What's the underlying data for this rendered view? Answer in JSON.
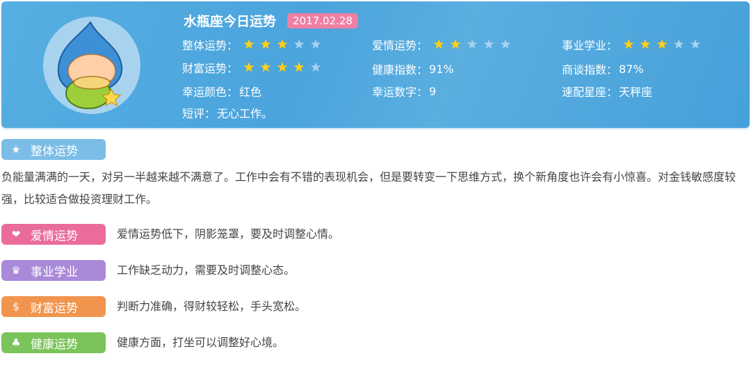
{
  "header": {
    "title": "水瓶座今日运势",
    "date": "2017.02.28"
  },
  "ratings": [
    {
      "label": "整体运势：",
      "stars": 3,
      "max": 5
    },
    {
      "label": "爱情运势：",
      "stars": 2,
      "max": 5
    },
    {
      "label": "事业学业：",
      "stars": 3,
      "max": 5
    },
    {
      "label": "财富运势：",
      "stars": 4,
      "max": 5
    }
  ],
  "stats": {
    "health": {
      "label": "健康指数：",
      "value": "91%"
    },
    "negotiation": {
      "label": "商谈指数：",
      "value": "87%"
    },
    "lucky_color": {
      "label": "幸运颜色：",
      "value": "红色"
    },
    "lucky_number": {
      "label": "幸运数字：",
      "value": "9"
    },
    "match": {
      "label": "速配星座：",
      "value": "天秤座"
    },
    "comment": {
      "label": "短评：",
      "value": "无心工作。"
    }
  },
  "sections": [
    {
      "label": "整体运势",
      "icon": "star-icon",
      "color": "#7bbde6",
      "text": "负能量满满的一天，对另一半越来越不满意了。工作中会有不错的表现机会，但是要转变一下思维方式，换个新角度也许会有小惊喜。对金钱敏感度较强，比较适合做投资理财工作。"
    },
    {
      "label": "爱情运势",
      "icon": "heart-icon",
      "color": "#ea6c9b",
      "text": "爱情运势低下，阴影笼罩，要及时调整心情。"
    },
    {
      "label": "事业学业",
      "icon": "crown-icon",
      "color": "#a98ad9",
      "text": "工作缺乏动力，需要及时调整心态。"
    },
    {
      "label": "财富运势",
      "icon": "coin-icon",
      "color": "#f1954e",
      "text": "判断力准确，得财较轻松，手头宽松。"
    },
    {
      "label": "健康运势",
      "icon": "clover-icon",
      "color": "#7bc35b",
      "text": "健康方面，打坐可以调整好心境。"
    }
  ]
}
